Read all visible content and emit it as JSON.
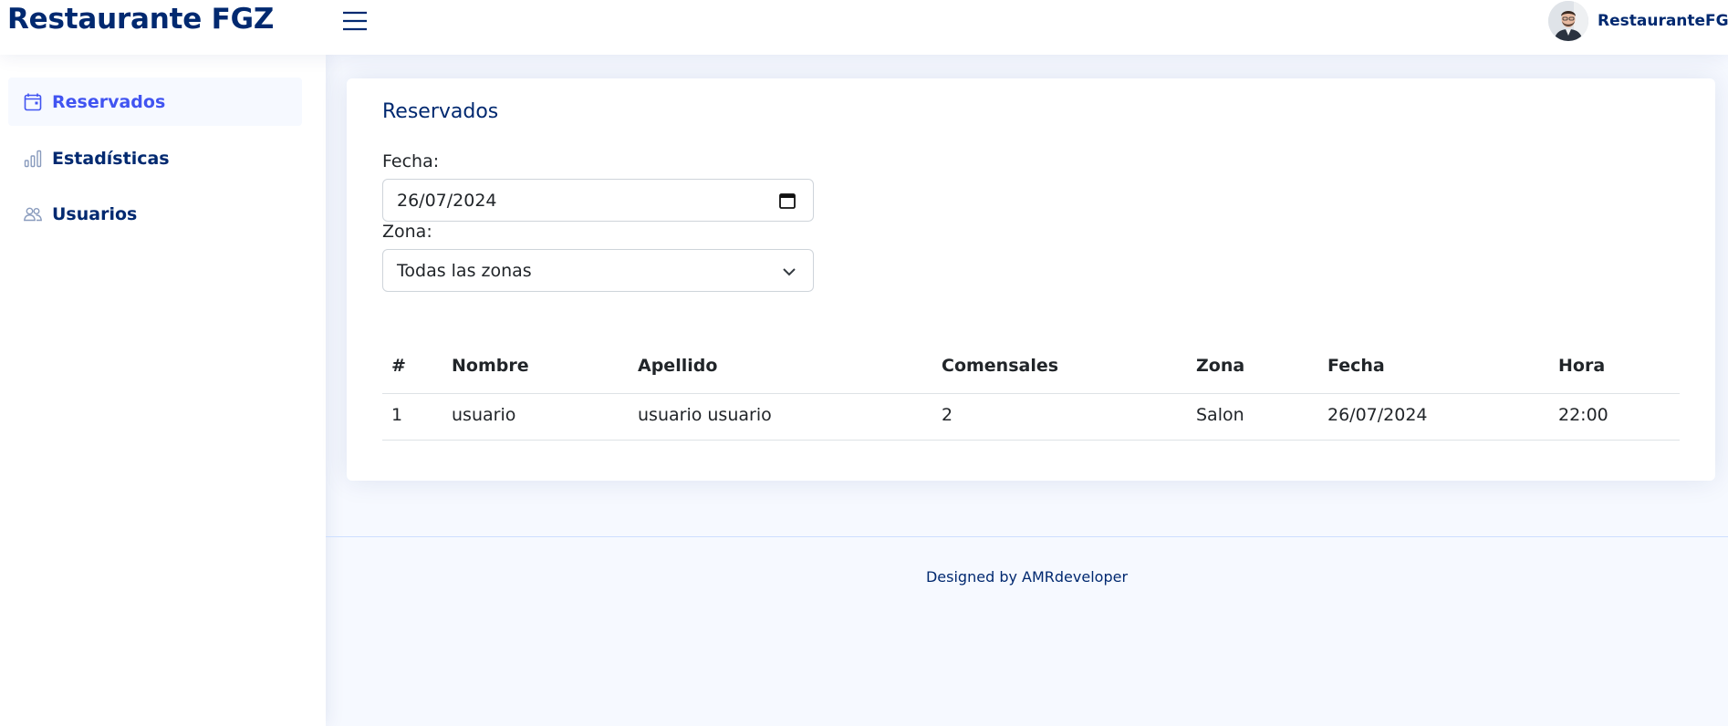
{
  "header": {
    "brand": "Restaurante FGZ",
    "user_name": "RestauranteFGZ"
  },
  "sidebar": {
    "items": [
      {
        "label": "Reservados",
        "icon": "calendar-icon",
        "active": true
      },
      {
        "label": "Estadísticas",
        "icon": "bar-chart-icon",
        "active": false
      },
      {
        "label": "Usuarios",
        "icon": "people-icon",
        "active": false
      }
    ]
  },
  "main": {
    "card_title": "Reservados",
    "date_label": "Fecha:",
    "date_value": "26/07/2024",
    "zone_label": "Zona:",
    "zone_value": "Todas las zonas",
    "table": {
      "columns": [
        "#",
        "Nombre",
        "Apellido",
        "Comensales",
        "Zona",
        "Fecha",
        "Hora"
      ],
      "rows": [
        [
          "1",
          "usuario",
          "usuario usuario",
          "2",
          "Salon",
          "26/07/2024",
          "22:00"
        ]
      ]
    }
  },
  "footer": {
    "text": "Designed by AMRdeveloper"
  },
  "colors": {
    "brand": "#012970",
    "accent": "#4154f1",
    "page_background": "#f6f9ff"
  }
}
